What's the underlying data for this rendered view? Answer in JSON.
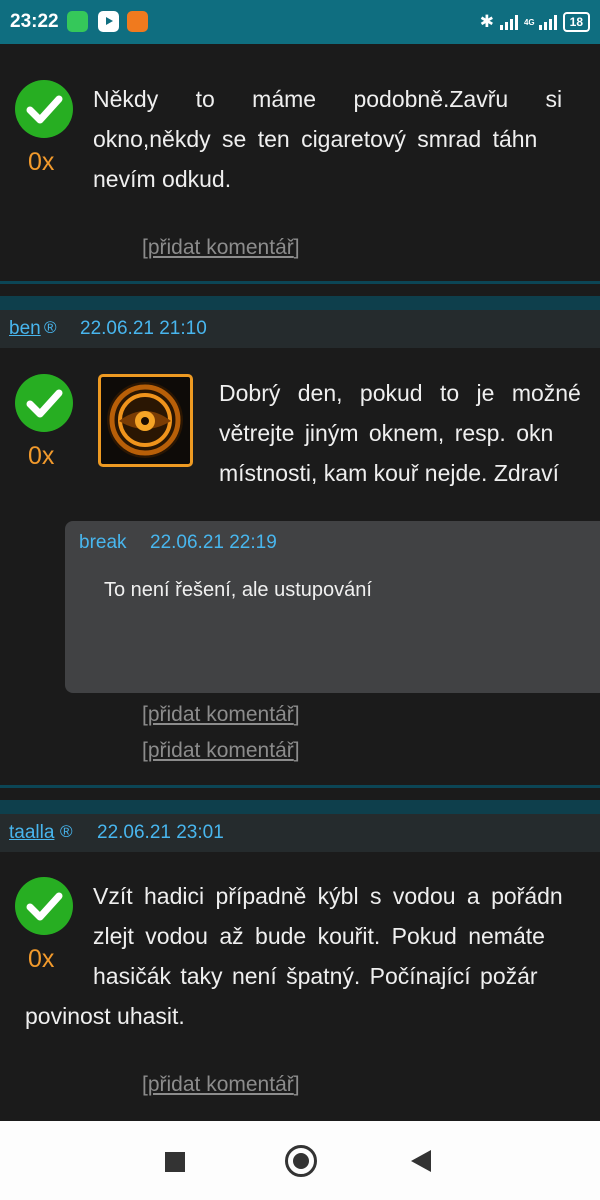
{
  "status_bar": {
    "time": "23:22",
    "network": "4G",
    "battery": "18",
    "icons": [
      "app-notification-icon",
      "youtube-icon",
      "app-icon",
      "bluetooth-icon",
      "signal-icon",
      "battery-icon"
    ]
  },
  "posts": [
    {
      "votes": "0x",
      "text_lines": [
        "Někdy to máme podobně.Zavřu si",
        "okno,někdy se ten cigaretový smrad táhn",
        "nevím odkud."
      ],
      "add_comment": [
        "[",
        "přidat komentář",
        "]"
      ]
    },
    {
      "author": "ben",
      "reg_mark": "®",
      "date": "22.06.21 21:10",
      "votes": "0x",
      "text_lines": [
        "Dobrý den, pokud to je možné",
        "větrejte jiným oknem, resp. okn",
        "místnosti, kam kouř nejde. Zdraví"
      ],
      "comment": {
        "author": "break",
        "date": "22.06.21 22:19",
        "text": "To není řešení, ale ustupování"
      },
      "add_comment_1": [
        "[",
        "přidat komentář",
        "]"
      ],
      "add_comment_2": [
        "[",
        "přidat komentář",
        "]"
      ]
    },
    {
      "author": "taalla",
      "reg_mark": "®",
      "date": "22.06.21 23:01",
      "votes": "0x",
      "text_lines": [
        "Vzít hadici případně kýbl s vodou a pořádn",
        "zlejt vodou až bude kouřit. Pokud nemáte",
        "hasičák taky není špatný. Počínající požár",
        "povinost uhasit."
      ],
      "add_comment": [
        "[",
        "přidat komentář",
        "]"
      ]
    }
  ],
  "colors": {
    "accent": "#48b6ee",
    "vote_green": "#27ae22",
    "count_orange": "#f29a2c",
    "status_bar": "#0f6e80"
  }
}
